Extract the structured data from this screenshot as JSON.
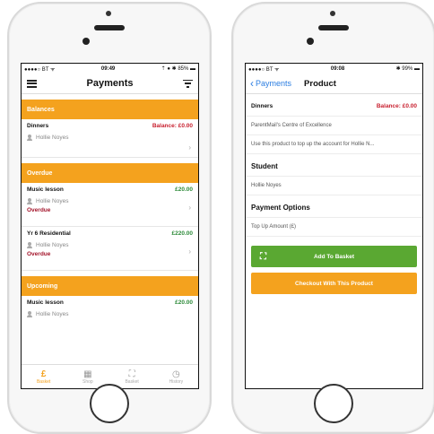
{
  "phone1": {
    "status": {
      "carrier": "●●●●○ BT ᯤ",
      "time": "09:49",
      "battery": "⇡ ● ✱ 85% ▬"
    },
    "nav": {
      "title": "Payments"
    },
    "sections": {
      "balances": {
        "label": "Balances",
        "rows": [
          {
            "name": "Dinners",
            "value": "Balance: £0.00",
            "student": "Hollie Noyes"
          }
        ]
      },
      "overdue": {
        "label": "Overdue",
        "rows": [
          {
            "name": "Music lesson",
            "value": "£20.00",
            "student": "Hollie Noyes",
            "status": "Overdue"
          },
          {
            "name": "Yr 6 Residential",
            "value": "£220.00",
            "student": "Hollie Noyes",
            "status": "Overdue"
          }
        ]
      },
      "upcoming": {
        "label": "Upcoming",
        "rows": [
          {
            "name": "Music lesson",
            "value": "£20.00",
            "student": "Hollie Noyes"
          }
        ]
      }
    },
    "tabs": [
      {
        "label": "Basket",
        "icon": "£"
      },
      {
        "label": "Shop",
        "icon": "▦"
      },
      {
        "label": "Basket",
        "icon": "⛶"
      },
      {
        "label": "History",
        "icon": "◷"
      }
    ]
  },
  "phone2": {
    "status": {
      "carrier": "●●●●○ BT ᯤ",
      "time": "09:08",
      "battery": "✱ 99% ▬"
    },
    "nav": {
      "back_label": "Payments",
      "title": "Product"
    },
    "product": {
      "name": "Dinners",
      "balance": "Balance: £0.00",
      "provider": "ParentMail's Centre of Excellence",
      "description": "Use this product to top up the account for Hollie N..."
    },
    "student": {
      "heading": "Student",
      "name": "Hollie Noyes"
    },
    "payment_options": {
      "heading": "Payment Options",
      "top_up_label": "Top Up Amount (£)"
    },
    "buttons": {
      "add_to_basket": "Add To Basket",
      "checkout": "Checkout With This Product"
    }
  },
  "colors": {
    "accent_orange": "#f4a21e",
    "green": "#5aa832",
    "red": "#c8202f",
    "blue": "#2a7de1"
  }
}
